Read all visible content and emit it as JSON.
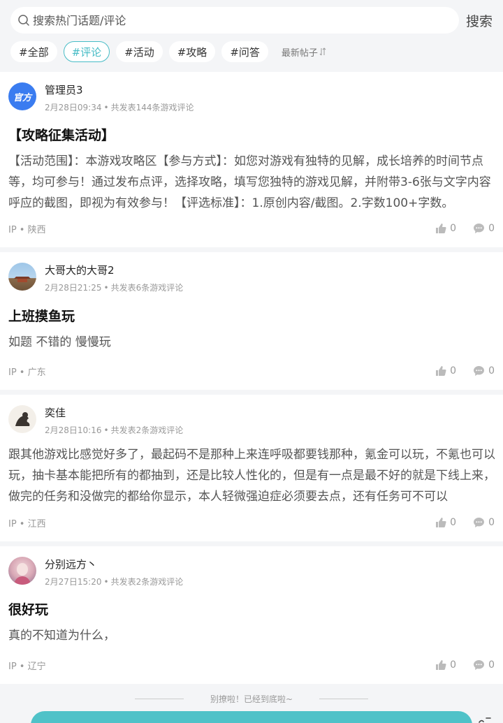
{
  "search": {
    "placeholder": "搜索热门话题/评论",
    "button": "搜索"
  },
  "tabs": [
    {
      "label": "#全部",
      "active": false
    },
    {
      "label": "#评论",
      "active": true
    },
    {
      "label": "#活动",
      "active": false
    },
    {
      "label": "#攻略",
      "active": false
    },
    {
      "label": "#问答",
      "active": false
    }
  ],
  "sort": {
    "label": "最新帖子"
  },
  "posts": [
    {
      "avatar_text": "官方",
      "username": "管理员3",
      "time": "2月28日09:34",
      "count_text": "共发表144条游戏评论",
      "title": "【攻略征集活动】",
      "body": "【活动范围】：本游戏攻略区【参与方式】：如您对游戏有独特的见解，成长培养的时间节点等，均可参与！通过发布点评，选择攻略，填写您独特的游戏见解，并附带3-6张与文字内容呼应的截图，即视为有效参与！【评选标准】：1.原创内容/截图。2.字数100+字数。",
      "ip": "IP • 陕西",
      "likes": "0",
      "comments": "0"
    },
    {
      "username": "大哥大的大哥2",
      "time": "2月28日21:25",
      "count_text": "共发表6条游戏评论",
      "title": "上班摸鱼玩",
      "body": "如题 不错的 慢慢玩",
      "ip": "IP • 广东",
      "likes": "0",
      "comments": "0"
    },
    {
      "username": "奕佳",
      "time": "2月28日10:16",
      "count_text": "共发表2条游戏评论",
      "title": "",
      "body": "跟其他游戏比感觉好多了，最起码不是那种上来连呼吸都要钱那种，氪金可以玩，不氪也可以玩，抽卡基本能把所有的都抽到，还是比较人性化的，但是有一点是最不好的就是下线上来，做完的任务和没做完的都给你显示，本人轻微强迫症必须要去点，还有任务可不可以",
      "ip": "IP • 江西",
      "likes": "0",
      "comments": "0"
    },
    {
      "username": "分别远方丶",
      "time": "2月27日15:20",
      "count_text": "共发表2条游戏评论",
      "title": "很好玩",
      "body": "真的不知道为什么，",
      "ip": "IP • 辽宁",
      "likes": "0",
      "comments": "0"
    }
  ],
  "footer": {
    "end_text": "别撩啦！已经到底啦~"
  },
  "colors": {
    "accent": "#47bcc6",
    "bar": "#4fc2c8",
    "official_badge": "#3a7cf0"
  }
}
